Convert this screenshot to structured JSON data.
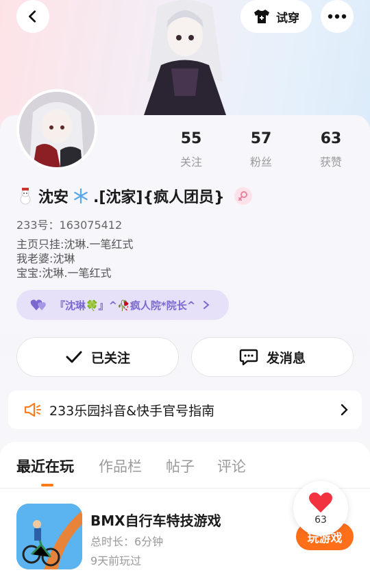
{
  "header": {
    "tryon_label": "试穿",
    "colors": {
      "accent": "#ff6f1a",
      "tag_text": "#7b68d1",
      "gender": "#e8829c"
    }
  },
  "stats": [
    {
      "value": "55",
      "label": "关注"
    },
    {
      "value": "57",
      "label": "粉丝"
    },
    {
      "value": "63",
      "label": "获赞"
    }
  ],
  "profile": {
    "name_prefix": "沈安",
    "name_suffix": ".[沈家]{疯人团员}",
    "uid": "233号：163075412",
    "bio": [
      "主页只挂:沈琳.一笔红式",
      "我老婆:沈琳",
      "宝宝:沈琳.一笔红式"
    ],
    "tag": "『沈琳🍀』^🥀疯人院*院长^"
  },
  "actions": {
    "follow_label": "已关注",
    "message_label": "发消息"
  },
  "notice": {
    "text": "233乐园抖音&快手官号指南"
  },
  "tabs": [
    {
      "label": "最近在玩",
      "active": true
    },
    {
      "label": "作品栏",
      "active": false
    },
    {
      "label": "帖子",
      "active": false
    },
    {
      "label": "评论",
      "active": false
    }
  ],
  "recent_game": {
    "title": "BMX自行车特技游戏",
    "duration": "总时长：6分钟",
    "last_played": "9天前玩过",
    "play_label": "玩游戏"
  },
  "likes": {
    "count": "63"
  }
}
